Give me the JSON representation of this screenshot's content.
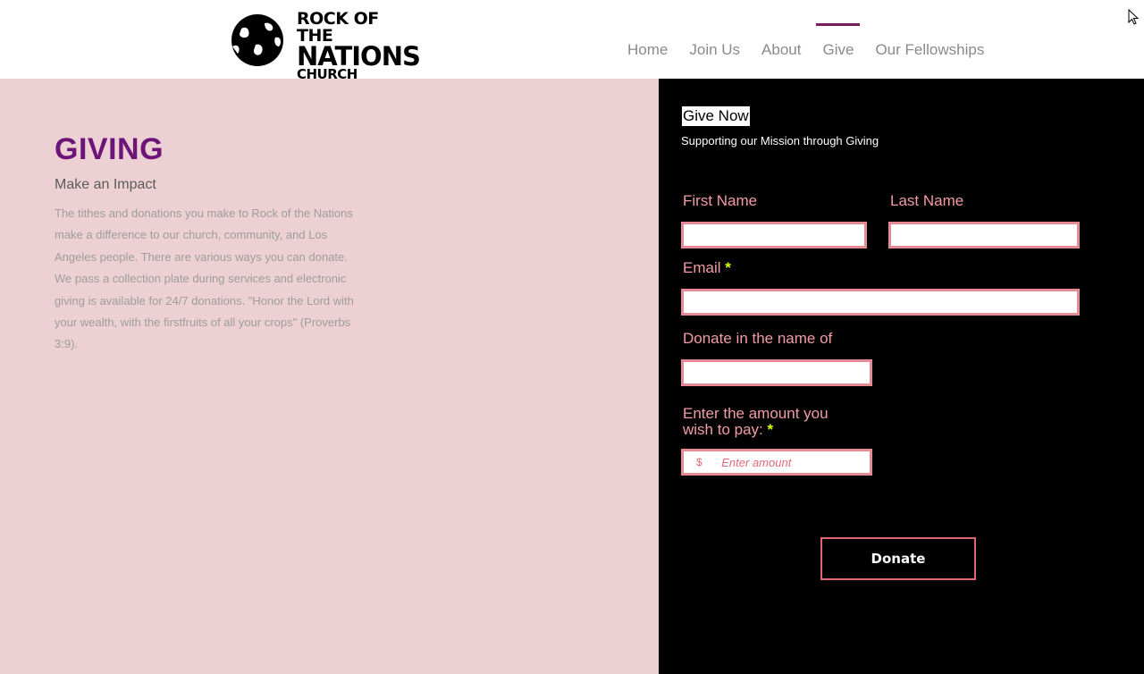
{
  "header": {
    "logo": {
      "line1": "ROCK OF THE",
      "line2": "NATIONS",
      "line3": "CHURCH"
    },
    "nav": [
      {
        "label": "Home",
        "active": false
      },
      {
        "label": "Join Us",
        "active": false
      },
      {
        "label": "About",
        "active": false
      },
      {
        "label": "Give",
        "active": true
      },
      {
        "label": "Our Fellowships",
        "active": false
      }
    ]
  },
  "giving": {
    "title": "GIVING",
    "subtitle": "Make an Impact",
    "body": "The tithes and donations you make to Rock of the Nations make a difference to our church, community, and Los Angeles people. There are various ways you can donate. We pass a collection plate during services and electronic giving is available for 24/7 donations. \"Honor the Lord with your wealth, with the firstfruits of all your crops\" (Proverbs 3:9)."
  },
  "form": {
    "heading": "Give Now",
    "subheading": "Supporting our Mission through Giving",
    "first_name_label": "First Name",
    "last_name_label": "Last Name",
    "email_label": "Email",
    "required_marker": "*",
    "donate_name_label": "Donate in the name of",
    "amount_label_line1": "Enter the amount you",
    "amount_label_line2": "wish to pay:",
    "currency_symbol": "$",
    "amount_placeholder": "Enter amount",
    "first_name_value": "",
    "last_name_value": "",
    "email_value": "",
    "donate_name_value": "",
    "submit_label": "Donate"
  },
  "colors": {
    "nav_active": "#7b1c5e",
    "title_purple": "#6d1479",
    "left_bg": "#ecd0d4",
    "label_pink": "#f19ca6",
    "field_border": "#e68b94",
    "required_yellow": "#d8ff00",
    "button_border": "#e0666f"
  }
}
